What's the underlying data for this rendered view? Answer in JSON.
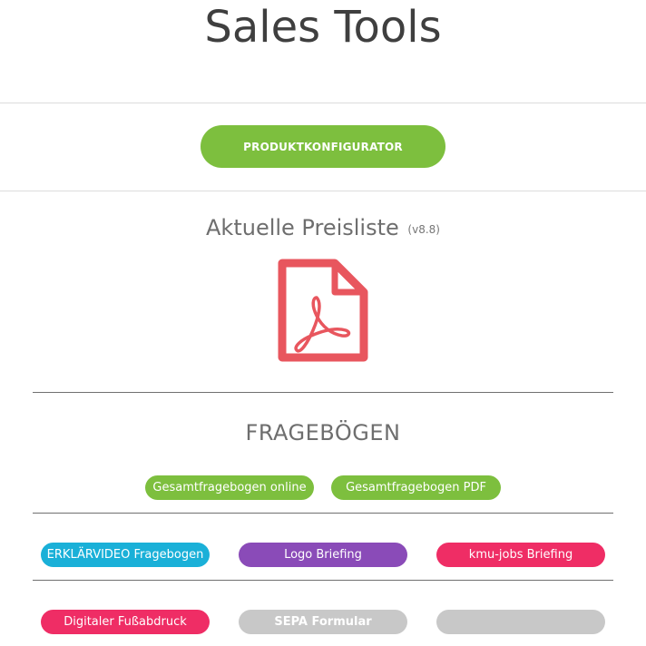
{
  "page": {
    "title": "Sales Tools"
  },
  "cta": {
    "label": "PRODUKTKONFIGURATOR"
  },
  "pricelist": {
    "title": "Aktuelle Preisliste",
    "version": "(v8.8)",
    "icon": "pdf-file-icon",
    "icon_color": "#e8565e"
  },
  "questionnaires": {
    "heading": "FRAGEBÖGEN",
    "row1": [
      "Gesamtfragebogen online",
      "Gesamtfragebogen PDF"
    ],
    "row2": [
      "ERKLÄRVIDEO Fragebogen",
      "Logo Briefing",
      "kmu-jobs Briefing"
    ],
    "row3": [
      "Digitaler Fußabdruck",
      "SEPA Formular",
      ""
    ]
  },
  "colors": {
    "green": "#7dbf3e",
    "blue": "#1ab0d8",
    "purple": "#8a4bb8",
    "pink": "#ef2d65",
    "grey": "#c8c8c8"
  }
}
